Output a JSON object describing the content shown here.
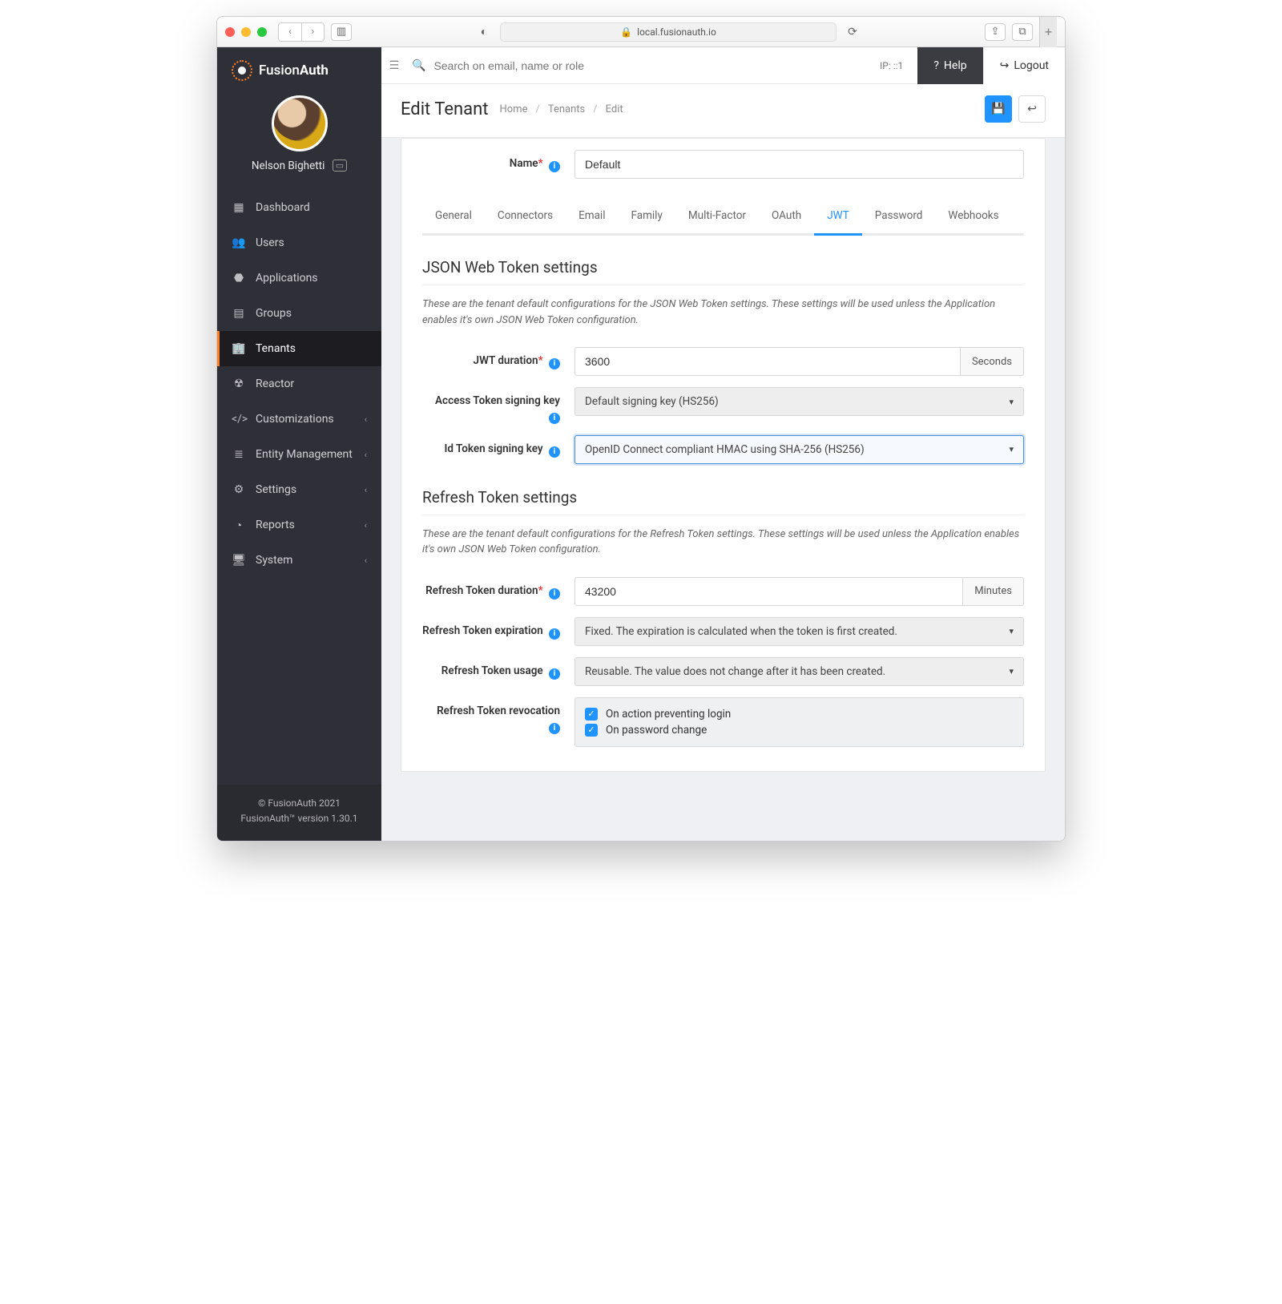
{
  "browser": {
    "url_host": "local.fusionauth.io"
  },
  "brand": {
    "name_a": "Fusion",
    "name_b": "Auth"
  },
  "user": {
    "display_name": "Nelson Bighetti"
  },
  "sidebar": {
    "items": [
      {
        "label": "Dashboard"
      },
      {
        "label": "Users"
      },
      {
        "label": "Applications"
      },
      {
        "label": "Groups"
      },
      {
        "label": "Tenants"
      },
      {
        "label": "Reactor"
      },
      {
        "label": "Customizations"
      },
      {
        "label": "Entity Management"
      },
      {
        "label": "Settings"
      },
      {
        "label": "Reports"
      },
      {
        "label": "System"
      }
    ],
    "footer_line1": "© FusionAuth 2021",
    "footer_line2": "FusionAuth™ version 1.30.1"
  },
  "topbar": {
    "search_placeholder": "Search on email, name or role",
    "ip_label": "IP: ::1",
    "help_label": "Help",
    "logout_label": "Logout"
  },
  "header": {
    "title": "Edit Tenant",
    "breadcrumbs": [
      "Home",
      "Tenants",
      "Edit"
    ]
  },
  "tenant": {
    "name_label": "Name",
    "name_value": "Default"
  },
  "tabs": [
    "General",
    "Connectors",
    "Email",
    "Family",
    "Multi-Factor",
    "OAuth",
    "JWT",
    "Password",
    "Webhooks"
  ],
  "jwt": {
    "heading": "JSON Web Token settings",
    "desc": "These are the tenant default configurations for the JSON Web Token settings. These settings will be used unless the Application enables it's own JSON Web Token configuration.",
    "duration_label": "JWT duration",
    "duration_value": "3600",
    "duration_unit": "Seconds",
    "access_key_label": "Access Token signing key",
    "access_key_value": "Default signing key (HS256)",
    "id_key_label": "Id Token signing key",
    "id_key_value": "OpenID Connect compliant HMAC using SHA-256 (HS256)"
  },
  "refresh": {
    "heading": "Refresh Token settings",
    "desc": "These are the tenant default configurations for the Refresh Token settings. These settings will be used unless the Application enables it's own JSON Web Token configuration.",
    "duration_label": "Refresh Token duration",
    "duration_value": "43200",
    "duration_unit": "Minutes",
    "expiration_label": "Refresh Token expiration",
    "expiration_value": "Fixed. The expiration is calculated when the token is first created.",
    "usage_label": "Refresh Token usage",
    "usage_value": "Reusable. The value does not change after it has been created.",
    "revocation_label": "Refresh Token revocation",
    "revocation_opts": [
      "On action preventing login",
      "On password change"
    ]
  }
}
